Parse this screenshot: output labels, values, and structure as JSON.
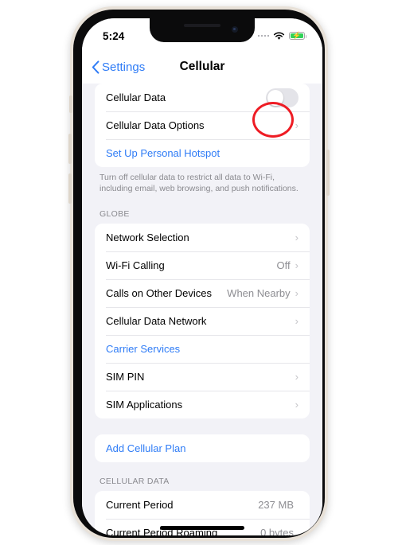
{
  "status_bar": {
    "time": "5:24",
    "signal_icon": "signal-dots-icon",
    "wifi_icon": "wifi-icon",
    "battery_icon": "battery-charging-icon"
  },
  "nav": {
    "back_label": "Settings",
    "back_icon": "chevron-left-icon",
    "title": "Cellular"
  },
  "sections": {
    "primary": {
      "rows": [
        {
          "label": "Cellular Data",
          "type": "toggle",
          "value": "off"
        },
        {
          "label": "Cellular Data Options",
          "type": "disclosure",
          "value": ""
        },
        {
          "label": "Set Up Personal Hotspot",
          "type": "link",
          "value": ""
        }
      ],
      "footnote": "Turn off cellular data to restrict all data to Wi-Fi, including email, web browsing, and push notifications."
    },
    "globe": {
      "header": "GLOBE",
      "rows": [
        {
          "label": "Network Selection",
          "type": "disclosure",
          "value": ""
        },
        {
          "label": "Wi-Fi Calling",
          "type": "disclosure",
          "value": "Off"
        },
        {
          "label": "Calls on Other Devices",
          "type": "disclosure",
          "value": "When Nearby"
        },
        {
          "label": "Cellular Data Network",
          "type": "disclosure",
          "value": ""
        },
        {
          "label": "Carrier Services",
          "type": "link",
          "value": ""
        },
        {
          "label": "SIM PIN",
          "type": "disclosure",
          "value": ""
        },
        {
          "label": "SIM Applications",
          "type": "disclosure",
          "value": ""
        }
      ]
    },
    "plan": {
      "rows": [
        {
          "label": "Add Cellular Plan",
          "type": "link",
          "value": ""
        }
      ]
    },
    "cellular_data": {
      "header": "CELLULAR DATA",
      "rows": [
        {
          "label": "Current Period",
          "type": "value",
          "value": "237 MB"
        },
        {
          "label": "Current Period Roaming",
          "type": "value",
          "value": "0 bytes"
        }
      ]
    }
  },
  "annotation": {
    "shape": "circle",
    "color": "#ee1c24",
    "target": "Cellular Data toggle"
  },
  "colors": {
    "accent_blue": "#2f7cf6",
    "background": "#f2f2f7",
    "card": "#ffffff",
    "secondary_text": "#8e8e93",
    "battery_green": "#31d158",
    "annotation_red": "#ee1c24"
  }
}
